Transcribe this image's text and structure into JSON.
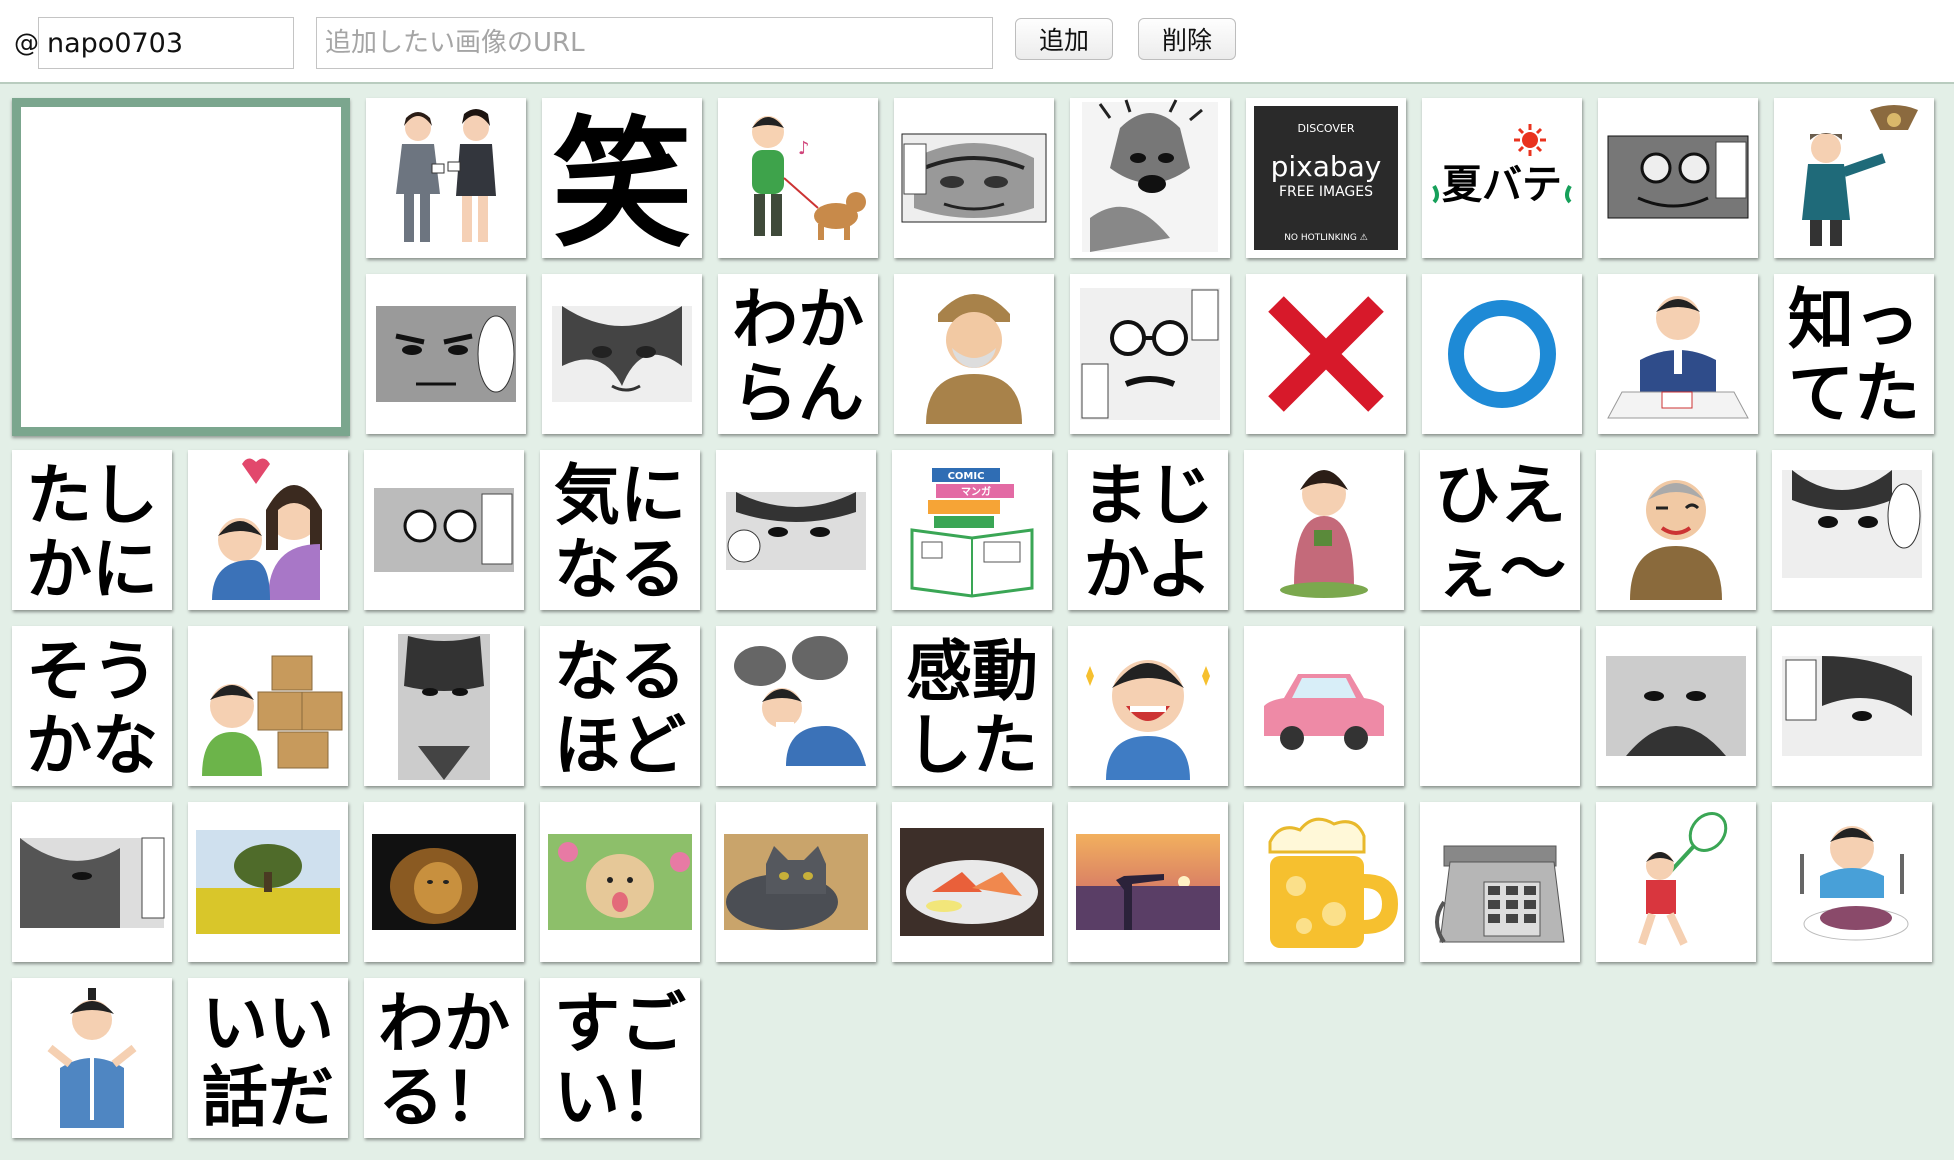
{
  "toolbar": {
    "at_symbol": "@",
    "username": "napo0703",
    "url_placeholder": "追加したい画像のURL",
    "add_label": "追加",
    "delete_label": "削除"
  },
  "stamps": {
    "warai": "笑",
    "wakaran": [
      "わか",
      "らん"
    ],
    "shitteta": [
      "知っ",
      "てた"
    ],
    "tashikani": [
      "たし",
      "かに"
    ],
    "kininaru": [
      "気に",
      "なる"
    ],
    "majikayo": [
      "まじ",
      "かよ"
    ],
    "hiee": [
      "ひえ",
      "ぇ〜"
    ],
    "soukana": [
      "そう",
      "かな"
    ],
    "naruhodo": [
      "なる",
      "ほど"
    ],
    "kandou": [
      "感動",
      "した"
    ],
    "iihanashi": [
      "いい",
      "話だ"
    ],
    "wakaru": [
      "わか",
      "る！"
    ],
    "sugoi": [
      "すご",
      "い！"
    ]
  },
  "pixabay": {
    "discover": "DISCOVER",
    "brand": "pixabay",
    "free": "FREE IMAGES",
    "nohotlink": "NO HOTLINKING ⚠"
  },
  "natsubate": "夏バテ",
  "comic_book": {
    "line1": "COMIC",
    "line2": "マンガ"
  },
  "colors": {
    "accent_border": "#7ba68e",
    "background": "#e3efe7",
    "cross_red": "#d7192a",
    "circle_blue": "#1e8ad6",
    "natsubate_green": "#16a05a"
  }
}
